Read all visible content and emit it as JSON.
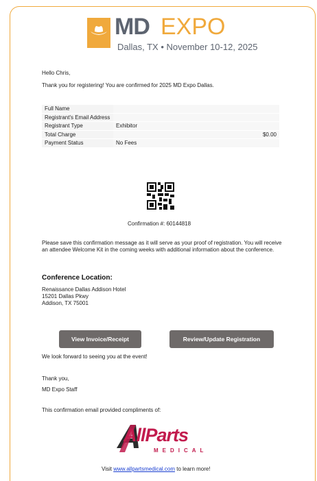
{
  "header": {
    "logo_md": "MD",
    "logo_expo": "EXPO",
    "subtitle": "Dallas, TX • November 10-12, 2025"
  },
  "greeting": "Hello Chris,",
  "intro": "Thank you for registering! You are confirmed for 2025 MD Expo Dallas.",
  "registration_table": [
    {
      "label": "Full Name",
      "value": ""
    },
    {
      "label": "Registrant's Email Address",
      "value": ""
    },
    {
      "label": "Registrant Type",
      "value": "Exhibitor"
    },
    {
      "label": "Total Charge",
      "value": "$0.00"
    },
    {
      "label": "Payment Status",
      "value": "No Fees"
    }
  ],
  "confirmation": "Confirmation #: 60144818",
  "save_message": "Please save this confirmation message as it will serve as your proof of registration. You will receive an attendee Welcome Kit in the coming weeks with additional information about the conference.",
  "location": {
    "heading": "Conference Location:",
    "line1": "Renaissance Dallas Addison Hotel",
    "line2": "15201 Dallas Pkwy",
    "line3": "Addison, TX 75001"
  },
  "buttons": {
    "invoice": "View Invoice/Receipt",
    "review": "Review/Update Registration"
  },
  "closing": "We look forward to seeing you at the event!",
  "thanks": "Thank you,",
  "signature": "MD Expo Staff",
  "compliments": "This confirmation email provided compliments of:",
  "sponsor": {
    "logo_main": "AllParts",
    "logo_sub": "MEDICAL",
    "visit_prefix": "Visit ",
    "visit_link": "www.allpartsmedical.com",
    "visit_suffix": " to learn more!"
  },
  "colors": {
    "accent": "#f0a93c",
    "logo_gray": "#5d6470",
    "button": "#6e6a69",
    "sponsor": "#c21b4d"
  }
}
